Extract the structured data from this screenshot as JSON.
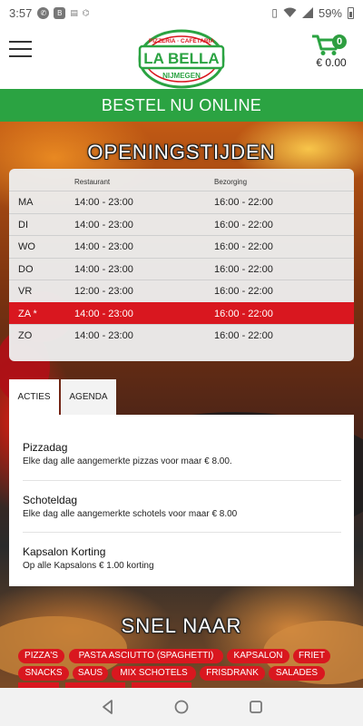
{
  "status_bar": {
    "time": "3:57",
    "notification_icons": [
      "whatsapp-icon",
      "b-app-icon",
      "news-app-icon",
      "gamepad-icon"
    ],
    "system_icons": [
      "vibrate-icon",
      "wifi-icon",
      "signal-icon"
    ],
    "battery": "59%"
  },
  "header": {
    "logo": {
      "top_text": "PIZZERIA · CAFETARIA",
      "name": "LA BELLA",
      "city": "NIJMEGEN"
    },
    "cart": {
      "count": "0",
      "total": "€ 0.00"
    }
  },
  "order_bar": {
    "label": "BESTEL NU ONLINE"
  },
  "opening_hours": {
    "title": "OPENINGSTIJDEN",
    "columns": {
      "restaurant": "Restaurant",
      "delivery": "Bezorging"
    },
    "rows": [
      {
        "day": "MA",
        "restaurant": "14:00 - 23:00",
        "delivery": "16:00 - 22:00"
      },
      {
        "day": "DI",
        "restaurant": "14:00 - 23:00",
        "delivery": "16:00 - 22:00"
      },
      {
        "day": "WO",
        "restaurant": "14:00 - 23:00",
        "delivery": "16:00 - 22:00"
      },
      {
        "day": "DO",
        "restaurant": "14:00 - 23:00",
        "delivery": "16:00 - 22:00"
      },
      {
        "day": "VR",
        "restaurant": "12:00 - 23:00",
        "delivery": "16:00 - 22:00"
      },
      {
        "day": "ZA *",
        "restaurant": "14:00 - 23:00",
        "delivery": "16:00 - 22:00"
      },
      {
        "day": "ZO",
        "restaurant": "14:00 - 23:00",
        "delivery": "16:00 - 22:00"
      }
    ]
  },
  "tabs": [
    {
      "label": "ACTIES",
      "active": true
    },
    {
      "label": "AGENDA",
      "active": false
    }
  ],
  "actions": [
    {
      "title": "Pizzadag",
      "description": "Elke dag alle aangemerkte pizzas voor maar € 8.00."
    },
    {
      "title": "Schoteldag",
      "description": "Elke dag alle aangemerkte schotels voor maar € 8.00"
    },
    {
      "title": "Kapsalon Korting",
      "description": "Op alle Kapsalons € 1.00 korting"
    }
  ],
  "quick_links": {
    "title": "SNEL NAAR",
    "items": [
      "PIZZA'S",
      "PASTA ASCIUTTO (SPAGHETTI)",
      "KAPSALON",
      "FRIET",
      "SNACKS",
      "SAUS",
      "MIX SCHOTELS",
      "FRISDRANK",
      "SALADES"
    ]
  },
  "nav_bar": {
    "buttons": [
      "back-icon",
      "home-icon",
      "recents-icon"
    ]
  },
  "colors": {
    "green": "#2ba342",
    "red": "#d9171f",
    "card": "#ececec"
  }
}
